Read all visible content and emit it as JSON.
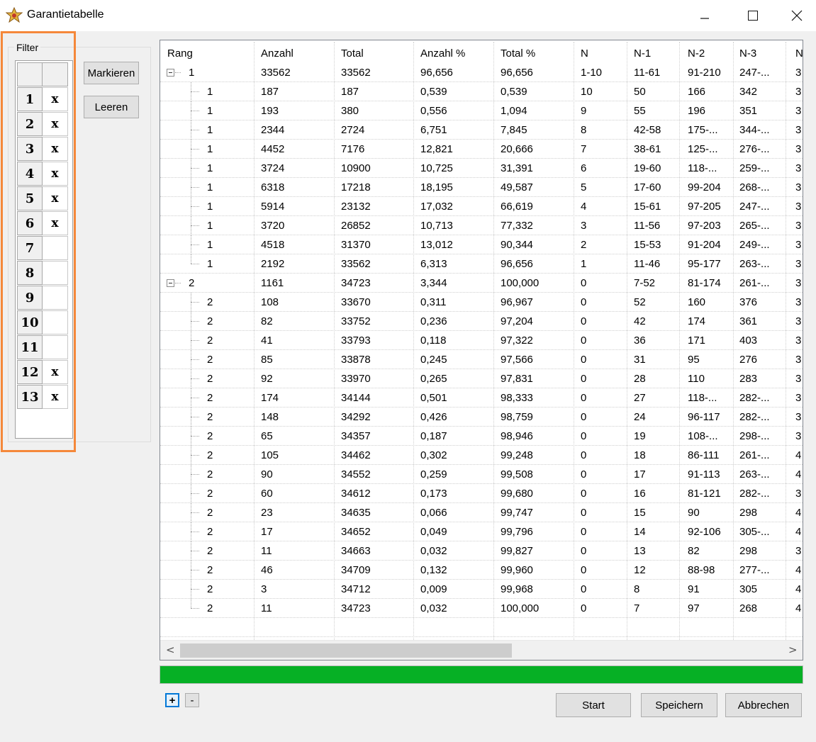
{
  "window": {
    "title": "Garantietabelle"
  },
  "filter": {
    "legend": "Filter",
    "rows": [
      {
        "num": "1",
        "val": "x"
      },
      {
        "num": "2",
        "val": "x"
      },
      {
        "num": "3",
        "val": "x"
      },
      {
        "num": "4",
        "val": "x"
      },
      {
        "num": "5",
        "val": "x"
      },
      {
        "num": "6",
        "val": "x"
      },
      {
        "num": "7",
        "val": ""
      },
      {
        "num": "8",
        "val": ""
      },
      {
        "num": "9",
        "val": ""
      },
      {
        "num": "10",
        "val": ""
      },
      {
        "num": "11",
        "val": ""
      },
      {
        "num": "12",
        "val": "x"
      },
      {
        "num": "13",
        "val": "x"
      }
    ]
  },
  "buttons": {
    "markieren": "Markieren",
    "leeren": "Leeren",
    "expand": "+",
    "collapse": "-",
    "start": "Start",
    "speichern": "Speichern",
    "abbrechen": "Abbrechen"
  },
  "table": {
    "columns": [
      "Rang",
      "Anzahl",
      "Total",
      "Anzahl %",
      "Total %",
      "N",
      "N-1",
      "N-2",
      "N-3",
      "N"
    ],
    "rows": [
      {
        "level": 0,
        "cells": [
          "1",
          "33562",
          "33562",
          "96,656",
          "96,656",
          "1-10",
          "11-61",
          "91-210",
          "247-...",
          "3"
        ]
      },
      {
        "level": 1,
        "cells": [
          "1",
          "187",
          "187",
          "0,539",
          "0,539",
          "10",
          "50",
          "166",
          "342",
          "3"
        ]
      },
      {
        "level": 1,
        "cells": [
          "1",
          "193",
          "380",
          "0,556",
          "1,094",
          "9",
          "55",
          "196",
          "351",
          "3"
        ]
      },
      {
        "level": 1,
        "cells": [
          "1",
          "2344",
          "2724",
          "6,751",
          "7,845",
          "8",
          "42-58",
          "175-...",
          "344-...",
          "3"
        ]
      },
      {
        "level": 1,
        "cells": [
          "1",
          "4452",
          "7176",
          "12,821",
          "20,666",
          "7",
          "38-61",
          "125-...",
          "276-...",
          "3"
        ]
      },
      {
        "level": 1,
        "cells": [
          "1",
          "3724",
          "10900",
          "10,725",
          "31,391",
          "6",
          "19-60",
          "118-...",
          "259-...",
          "3"
        ]
      },
      {
        "level": 1,
        "cells": [
          "1",
          "6318",
          "17218",
          "18,195",
          "49,587",
          "5",
          "17-60",
          "99-204",
          "268-...",
          "3"
        ]
      },
      {
        "level": 1,
        "cells": [
          "1",
          "5914",
          "23132",
          "17,032",
          "66,619",
          "4",
          "15-61",
          "97-205",
          "247-...",
          "3"
        ]
      },
      {
        "level": 1,
        "cells": [
          "1",
          "3720",
          "26852",
          "10,713",
          "77,332",
          "3",
          "11-56",
          "97-203",
          "265-...",
          "3"
        ]
      },
      {
        "level": 1,
        "cells": [
          "1",
          "4518",
          "31370",
          "13,012",
          "90,344",
          "2",
          "15-53",
          "91-204",
          "249-...",
          "3"
        ]
      },
      {
        "level": 1,
        "cells": [
          "1",
          "2192",
          "33562",
          "6,313",
          "96,656",
          "1",
          "11-46",
          "95-177",
          "263-...",
          "3"
        ]
      },
      {
        "level": 0,
        "cells": [
          "2",
          "1161",
          "34723",
          "3,344",
          "100,000",
          "0",
          "7-52",
          "81-174",
          "261-...",
          "3"
        ]
      },
      {
        "level": 1,
        "cells": [
          "2",
          "108",
          "33670",
          "0,311",
          "96,967",
          "0",
          "52",
          "160",
          "376",
          "3"
        ]
      },
      {
        "level": 1,
        "cells": [
          "2",
          "82",
          "33752",
          "0,236",
          "97,204",
          "0",
          "42",
          "174",
          "361",
          "3"
        ]
      },
      {
        "level": 1,
        "cells": [
          "2",
          "41",
          "33793",
          "0,118",
          "97,322",
          "0",
          "36",
          "171",
          "403",
          "3"
        ]
      },
      {
        "level": 1,
        "cells": [
          "2",
          "85",
          "33878",
          "0,245",
          "97,566",
          "0",
          "31",
          "95",
          "276",
          "3"
        ]
      },
      {
        "level": 1,
        "cells": [
          "2",
          "92",
          "33970",
          "0,265",
          "97,831",
          "0",
          "28",
          "110",
          "283",
          "3"
        ]
      },
      {
        "level": 1,
        "cells": [
          "2",
          "174",
          "34144",
          "0,501",
          "98,333",
          "0",
          "27",
          "118-...",
          "282-...",
          "3"
        ]
      },
      {
        "level": 1,
        "cells": [
          "2",
          "148",
          "34292",
          "0,426",
          "98,759",
          "0",
          "24",
          "96-117",
          "282-...",
          "3"
        ]
      },
      {
        "level": 1,
        "cells": [
          "2",
          "65",
          "34357",
          "0,187",
          "98,946",
          "0",
          "19",
          "108-...",
          "298-...",
          "3"
        ]
      },
      {
        "level": 1,
        "cells": [
          "2",
          "105",
          "34462",
          "0,302",
          "99,248",
          "0",
          "18",
          "86-111",
          "261-...",
          "4"
        ]
      },
      {
        "level": 1,
        "cells": [
          "2",
          "90",
          "34552",
          "0,259",
          "99,508",
          "0",
          "17",
          "91-113",
          "263-...",
          "4"
        ]
      },
      {
        "level": 1,
        "cells": [
          "2",
          "60",
          "34612",
          "0,173",
          "99,680",
          "0",
          "16",
          "81-121",
          "282-...",
          "3"
        ]
      },
      {
        "level": 1,
        "cells": [
          "2",
          "23",
          "34635",
          "0,066",
          "99,747",
          "0",
          "15",
          "90",
          "298",
          "4"
        ]
      },
      {
        "level": 1,
        "cells": [
          "2",
          "17",
          "34652",
          "0,049",
          "99,796",
          "0",
          "14",
          "92-106",
          "305-...",
          "4"
        ]
      },
      {
        "level": 1,
        "cells": [
          "2",
          "11",
          "34663",
          "0,032",
          "99,827",
          "0",
          "13",
          "82",
          "298",
          "3"
        ]
      },
      {
        "level": 1,
        "cells": [
          "2",
          "46",
          "34709",
          "0,132",
          "99,960",
          "0",
          "12",
          "88-98",
          "277-...",
          "4"
        ]
      },
      {
        "level": 1,
        "cells": [
          "2",
          "3",
          "34712",
          "0,009",
          "99,968",
          "0",
          "8",
          "91",
          "305",
          "4"
        ]
      },
      {
        "level": 1,
        "cells": [
          "2",
          "11",
          "34723",
          "0,032",
          "100,000",
          "0",
          "7",
          "97",
          "268",
          "4"
        ]
      }
    ]
  },
  "progress": {
    "value": 1.0,
    "color": "#06b025"
  },
  "colors": {
    "highlight": "#f5883a",
    "selection_focus": "#0078d7"
  }
}
